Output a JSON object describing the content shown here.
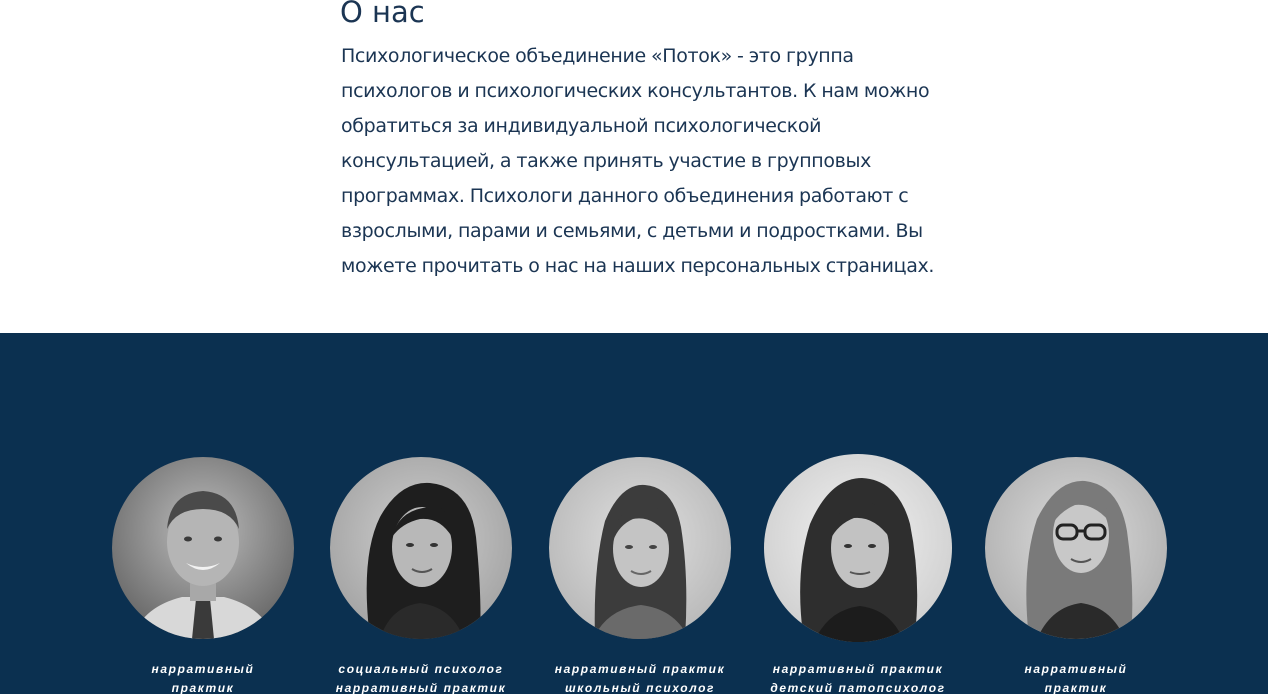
{
  "about": {
    "title": "О нас",
    "lines": [
      "Психологическое объединение «Поток» - это группа",
      "психологов и психологических консультантов. К нам можно",
      "обратиться за индивидуальной психологической",
      "консультацией, а также принять участие в групповых",
      "программах. Психологи данного объединения работают с",
      "взрослыми, парами и семьями, с детьми и подростками. Вы",
      "можете прочитать о нас на наших персональных страницах."
    ]
  },
  "team": {
    "members": [
      {
        "lines": [
          "нарративный",
          "практик"
        ]
      },
      {
        "lines": [
          "социальный психолог",
          "нарративный практик"
        ]
      },
      {
        "lines": [
          "нарративный практик",
          "школьный психолог"
        ]
      },
      {
        "lines": [
          "нарративный практик",
          "детский патопсихолог"
        ]
      },
      {
        "lines": [
          "нарративный",
          "практик"
        ]
      }
    ]
  },
  "colors": {
    "heading": "#1b3553",
    "band": "#0b3050",
    "role_text": "#ffffff"
  }
}
